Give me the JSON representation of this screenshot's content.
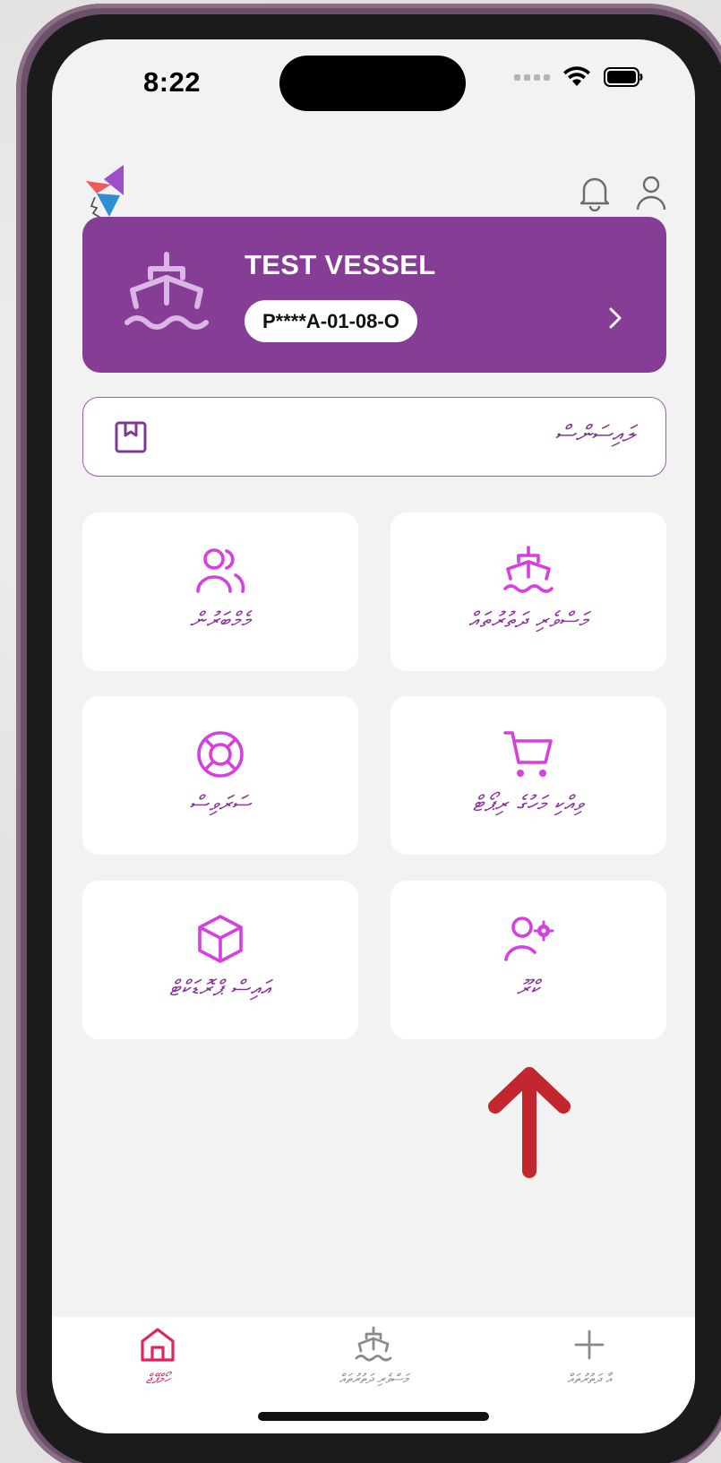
{
  "status_bar": {
    "time": "8:22"
  },
  "vessel": {
    "name": "TEST VESSEL",
    "registration": "P****A-01-08-O"
  },
  "document_bar": {
    "label": "ލައިސަންސް"
  },
  "tiles": [
    {
      "label": "މެމްބަރުން",
      "icon": "users-icon"
    },
    {
      "label": "މަސްވެރި ދަތުރުތައް",
      "icon": "ship-icon"
    },
    {
      "label": "ސަރަވިސް",
      "icon": "lifebuoy-icon"
    },
    {
      "label": "ވިއްކި މަހުގެ ރިޕޯޓް",
      "icon": "cart-icon"
    },
    {
      "label": "އައިސް ޕްރޮޑަކްޓް",
      "icon": "box-icon"
    },
    {
      "label": "ކްރޫ",
      "icon": "user-settings-icon"
    }
  ],
  "bottom_nav": [
    {
      "label": "ހޯމްޕޭޖް",
      "icon": "home-icon",
      "active": true
    },
    {
      "label": "މަސްވެރި ދަތުރުތައް",
      "icon": "ship-icon",
      "active": false
    },
    {
      "label": "އާ ދަތުރުތައް",
      "icon": "plus-icon",
      "active": false
    }
  ],
  "colors": {
    "brand_purple": "#863d96",
    "icon_magenta": "#d63fe0",
    "active_nav": "#e0245e",
    "annotation_arrow": "#c1272d"
  }
}
